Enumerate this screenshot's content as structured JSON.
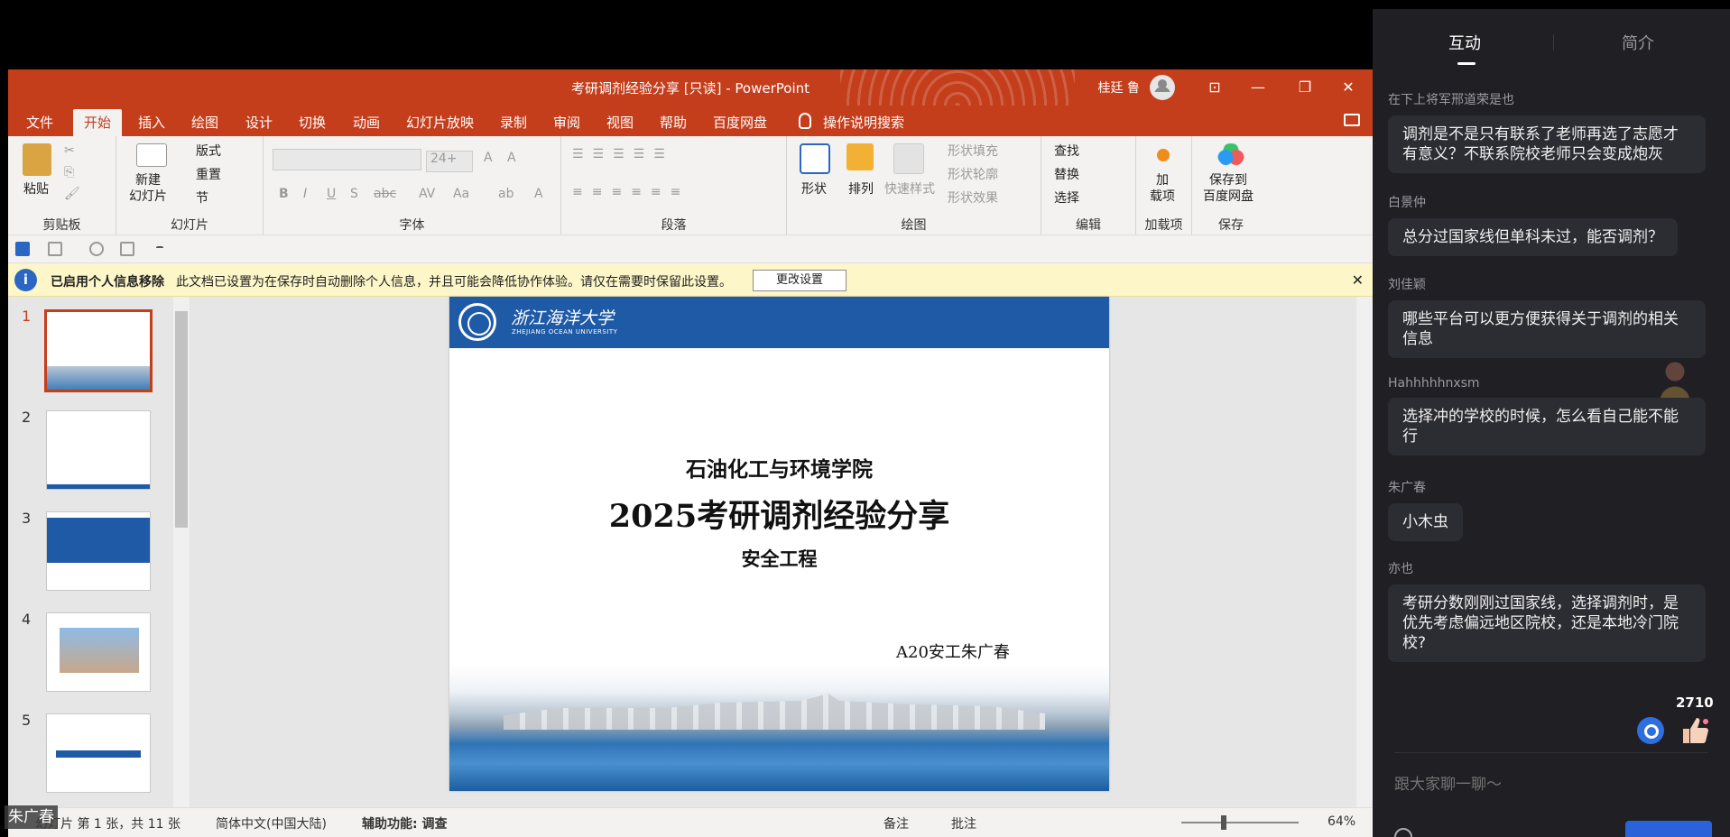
{
  "window": {
    "title": "考研调剂经验分享 [只读]  -  PowerPoint",
    "user": "桂廷 鲁"
  },
  "tabs": [
    "文件",
    "开始",
    "插入",
    "绘图",
    "设计",
    "切换",
    "动画",
    "幻灯片放映",
    "录制",
    "审阅",
    "视图",
    "帮助",
    "百度网盘"
  ],
  "search_label": "操作说明搜索",
  "ribbon": {
    "paste": "粘贴",
    "clipboard": "剪贴板",
    "new_slide": "新建\n幻灯片",
    "layout": "版式",
    "reset": "重置",
    "section": "节",
    "slides": "幻灯片",
    "font_size": "24+",
    "font_group": "字体",
    "paragraph": "段落",
    "shapes": "形状",
    "arrange": "排列",
    "quick_styles": "快速样式",
    "shape_fill": "形状填充",
    "shape_outline": "形状轮廓",
    "shape_effects": "形状效果",
    "drawing": "绘图",
    "find": "查找",
    "replace": "替换",
    "select": "选择",
    "editing": "编辑",
    "addins_btn": "加\n载项",
    "addins": "加载项",
    "save_baidu": "保存到\n百度网盘",
    "save": "保存"
  },
  "infobar": {
    "title": "已启用个人信息移除",
    "message": "此文档已设置为在保存时自动删除个人信息，并且可能会降低协作体验。请仅在需要时保留此设置。",
    "button": "更改设置"
  },
  "thumbnails": [
    "1",
    "2",
    "3",
    "4",
    "5"
  ],
  "slide": {
    "university": "浙江海洋大学",
    "university_en": "ZHEJIANG OCEAN UNIVERSITY",
    "line1": "石油化工与环境学院",
    "line2": "2025考研调剂经验分享",
    "line3": "安全工程",
    "author": "A20安工朱广春"
  },
  "statusbar": {
    "slide_info": "幻灯片 第 1 张，共 11 张",
    "language": "简体中文(中国大陆)",
    "accessibility": "辅助功能: 调查",
    "notes": "备注",
    "comments": "批注",
    "zoom": "64%"
  },
  "presenter_name": "朱广春",
  "panel": {
    "tab_interact": "互动",
    "tab_intro": "简介",
    "messages": [
      {
        "user": "在下上将军邢道荣是也",
        "text": "调剂是不是只有联系了老师再选了志愿才有意义？不联系院校老师只会变成炮灰"
      },
      {
        "user": "白景仲",
        "text": "总分过国家线但单科未过，能否调剂？"
      },
      {
        "user": "刘佳颖",
        "text": "哪些平台可以更方便获得关于调剂的相关信息"
      },
      {
        "user": "Hahhhhhnxsm",
        "text": "选择冲的学校的时候，怎么看自己能不能行"
      },
      {
        "user": "朱广春",
        "text": "小木虫"
      },
      {
        "user": "亦也",
        "text": "考研分数刚刚过国家线，选择调剂时，是优先考虑偏远地区院校，还是本地冷门院校?"
      }
    ],
    "like_count": "2710",
    "input_placeholder": "跟大家聊一聊～"
  }
}
